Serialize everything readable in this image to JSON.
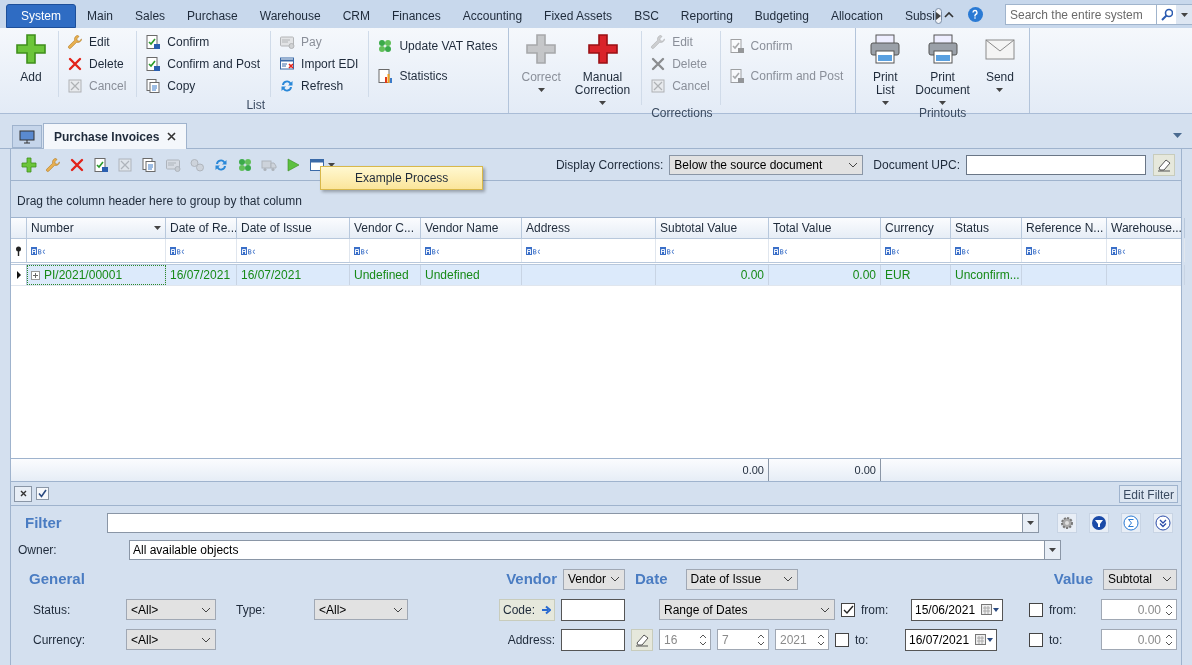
{
  "menu_tabs": [
    {
      "label": "System",
      "selected": true
    },
    {
      "label": "Main",
      "selected": false
    },
    {
      "label": "Sales",
      "selected": false
    },
    {
      "label": "Purchase",
      "selected": false
    },
    {
      "label": "Warehouse",
      "selected": false
    },
    {
      "label": "CRM",
      "selected": false
    },
    {
      "label": "Finances",
      "selected": false
    },
    {
      "label": "Accounting",
      "selected": false
    },
    {
      "label": "Fixed Assets",
      "selected": false
    },
    {
      "label": "BSC",
      "selected": false
    },
    {
      "label": "Reporting",
      "selected": false
    },
    {
      "label": "Budgeting",
      "selected": false
    },
    {
      "label": "Allocation",
      "selected": false
    },
    {
      "label": "Subsi",
      "selected": false
    }
  ],
  "search": {
    "placeholder": "Search the entire system"
  },
  "ribbon": [
    {
      "label": "List",
      "columns": [
        [
          {
            "kind": "large",
            "label": "Add",
            "disabled": false,
            "dropdown": false
          }
        ],
        [
          {
            "kind": "small",
            "label": "Edit",
            "disabled": false
          },
          {
            "kind": "small",
            "label": "Delete",
            "disabled": false
          },
          {
            "kind": "small",
            "label": "Cancel",
            "disabled": true
          }
        ],
        [
          {
            "kind": "small",
            "label": "Confirm",
            "disabled": false
          },
          {
            "kind": "small",
            "label": "Confirm and Post",
            "disabled": false
          },
          {
            "kind": "small",
            "label": "Copy",
            "disabled": false
          }
        ],
        [
          {
            "kind": "small",
            "label": "Pay",
            "disabled": true
          },
          {
            "kind": "small",
            "label": "Import EDI",
            "disabled": false
          },
          {
            "kind": "small",
            "label": "Refresh",
            "disabled": false
          }
        ],
        [
          {
            "kind": "small",
            "label": "Update VAT Rates",
            "disabled": false
          },
          {
            "kind": "small",
            "label": "Statistics",
            "disabled": false
          }
        ]
      ]
    },
    {
      "label": "Corrections",
      "columns": [
        [
          {
            "kind": "large",
            "label": "Correct",
            "disabled": true,
            "dropdown": true
          }
        ],
        [
          {
            "kind": "large",
            "label": "Manual Correction",
            "disabled": false,
            "dropdown": true
          }
        ],
        [
          {
            "kind": "small",
            "label": "Edit",
            "disabled": true
          },
          {
            "kind": "small",
            "label": "Delete",
            "disabled": true
          },
          {
            "kind": "small",
            "label": "Cancel",
            "disabled": true
          }
        ],
        [
          {
            "kind": "small",
            "label": "Confirm",
            "disabled": true
          },
          {
            "kind": "small",
            "label": "Confirm and Post",
            "disabled": true
          }
        ]
      ]
    },
    {
      "label": "Printouts",
      "columns": [
        [
          {
            "kind": "large",
            "label": "Print List",
            "disabled": false,
            "dropdown": true
          }
        ],
        [
          {
            "kind": "large",
            "label": "Print Document",
            "disabled": false,
            "dropdown": true
          }
        ],
        [
          {
            "kind": "large",
            "label": "Send",
            "disabled": false,
            "dropdown": true
          }
        ]
      ]
    }
  ],
  "document_tab": {
    "label": "Purchase Invoices",
    "selected": true
  },
  "toolbar": [
    {
      "disabled": false
    },
    {
      "disabled": false
    },
    {
      "disabled": false
    },
    {
      "disabled": false
    },
    {
      "disabled": true
    },
    {
      "disabled": false
    },
    {
      "disabled": true
    },
    {
      "disabled": true
    },
    {
      "disabled": false
    },
    {
      "disabled": false
    },
    {
      "disabled": true
    },
    {
      "disabled": false
    },
    {
      "disabled": false
    }
  ],
  "process_menu": {
    "label": "Example Process"
  },
  "display_corrections": {
    "label": "Display Corrections:",
    "value": "Below the source document"
  },
  "document_upc": {
    "label": "Document UPC:"
  },
  "group_panel": "Drag the column header here to group by that column",
  "table": {
    "columns": [
      {
        "label": "Number",
        "sorted": true
      },
      {
        "label": "Date of Re...",
        "sorted": false
      },
      {
        "label": "Date of Issue",
        "sorted": false
      },
      {
        "label": "Vendor C...",
        "sorted": false
      },
      {
        "label": "Vendor Name",
        "sorted": false
      },
      {
        "label": "Address",
        "sorted": false
      },
      {
        "label": "Subtotal Value",
        "sorted": false,
        "total": "0.00"
      },
      {
        "label": "Total Value",
        "sorted": false,
        "total": "0.00"
      },
      {
        "label": "Currency",
        "sorted": false
      },
      {
        "label": "Status",
        "sorted": false
      },
      {
        "label": "Reference N...",
        "sorted": false
      },
      {
        "label": "Warehouse...",
        "sorted": false
      }
    ],
    "rows": [
      {
        "selected": true,
        "cells": [
          "PI/2021/00001",
          "16/07/2021",
          "16/07/2021",
          "Undefined",
          "Undefined",
          null,
          "0.00",
          "0.00",
          "EUR",
          "Unconfirm...",
          null,
          null
        ]
      }
    ]
  },
  "filter_bar": {
    "checked": true,
    "edit_button": "Edit Filter"
  },
  "filter": {
    "label": "Filter"
  },
  "owner": {
    "label": "Owner:",
    "value": "All available objects"
  },
  "general": {
    "title": "General",
    "status": {
      "label": "Status:",
      "value": "<All>"
    },
    "type": {
      "label": "Type:",
      "value": "<All>"
    },
    "currency": {
      "label": "Currency:",
      "value": "<All>"
    }
  },
  "vendor": {
    "title": "Vendor",
    "selector": "Vendor",
    "code_button": "Code:",
    "address_label": "Address:"
  },
  "date": {
    "title": "Date",
    "selector": "Date of Issue",
    "range": "Range of Dates",
    "day": "16",
    "month": "7",
    "year": "2021",
    "from": {
      "label": "from:",
      "checked": true,
      "value": "15/06/2021"
    },
    "to": {
      "label": "to:",
      "checked": false,
      "value": "16/07/2021"
    }
  },
  "value": {
    "title": "Value",
    "selector": "Subtotal",
    "from": {
      "label": "from:",
      "checked": false,
      "value": "0.00"
    },
    "to": {
      "label": "to:",
      "checked": false,
      "value": "0.00"
    }
  }
}
